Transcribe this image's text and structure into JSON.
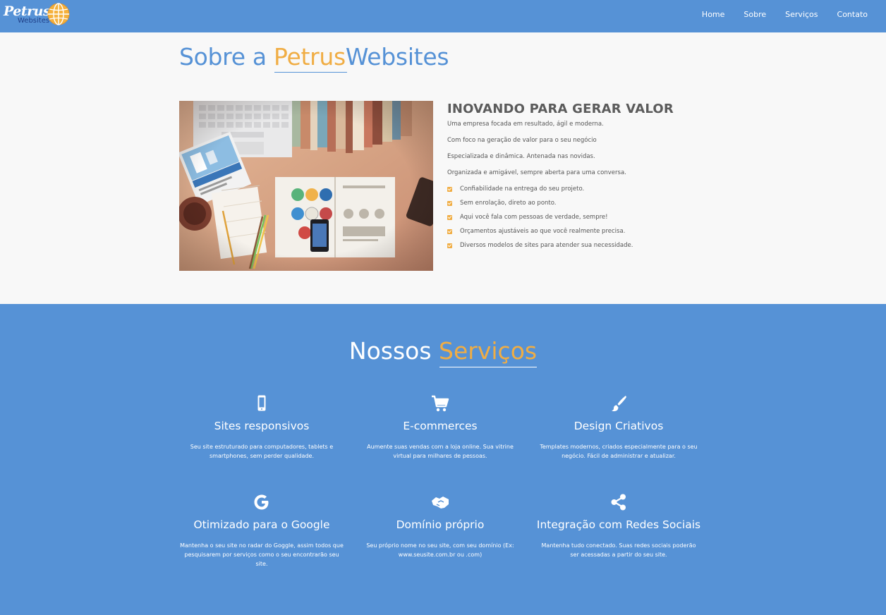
{
  "nav": {
    "logo_text": "Petrus",
    "logo_sub": "Websites",
    "links": [
      "Home",
      "Sobre",
      "Serviços",
      "Contato"
    ]
  },
  "about": {
    "title_prefix": "Sobre a ",
    "title_highlight": "Petrus",
    "title_suffix": "Websites",
    "heading": "INOVANDO PARA GERAR VALOR",
    "paragraphs": [
      "Uma empresa focada em resultado, ágil e moderna.",
      "Com foco na geração de valor para o seu negócio",
      "Especializada e dinâmica. Antenada nas novidas.",
      "Organizada e amigável, sempre aberta para uma conversa."
    ],
    "list": [
      "Confiabilidade na entrega do seu projeto.",
      "Sem enrolação, direto ao ponto.",
      "Aqui você fala com pessoas de verdade, sempre!",
      "Orçamentos ajustáveis ao que você realmente precisa.",
      "Diversos modelos de sites para atender sua necessidade."
    ]
  },
  "services": {
    "title_prefix": "Nossos ",
    "title_highlight": "Serviços",
    "items": [
      {
        "icon": "mobile-icon",
        "title": "Sites responsivos",
        "desc": "Seu site estruturado para computadores, tablets e smartphones, sem perder qualidade."
      },
      {
        "icon": "cart-icon",
        "title": "E-commerces",
        "desc": "Aumente suas vendas com a loja online. Sua vitrine virtual para milhares de pessoas."
      },
      {
        "icon": "brush-icon",
        "title": "Design Criativos",
        "desc": "Templates modernos, criados especialmente para o seu negócio. Fácil de administrar e atualizar."
      },
      {
        "icon": "google-icon",
        "title": "Otimizado para o Google",
        "desc": "Mantenha o seu site no radar do Goggle, assim todos que pesquisarem por serviços como o seu encontrarão seu site."
      },
      {
        "icon": "handshake-icon",
        "title": "Domínio próprio",
        "desc": "Seu próprio nome no seu site, com seu domínio (Ex: www.seusite.com.br ou .com)"
      },
      {
        "icon": "share-icon",
        "title": "Integração com Redes Sociais",
        "desc": "Mantenha tudo conectado. Suas redes sociais poderão ser acessadas a partir do seu site."
      }
    ]
  },
  "colors": {
    "primary": "#5692d6",
    "accent": "#f0ad44",
    "text": "#555555",
    "background": "#f8f8f8"
  }
}
